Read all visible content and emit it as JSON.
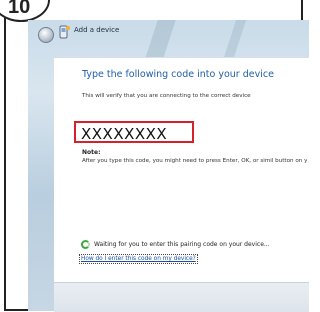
{
  "step": {
    "number": "10"
  },
  "window": {
    "title": "Add a device"
  },
  "main": {
    "heading": "Type the following code into your device",
    "subheading": "This will verify that you are connecting to the correct device",
    "code": "XXXXXXXX",
    "note_label": "Note:",
    "note_text": "After you type this code, you might need to press Enter, OK, or simil button on your device.",
    "waiting_text": "Waiting for you to enter this pairing code on your device...",
    "help_link": "How do I enter this code on my device?"
  },
  "colors": {
    "heading": "#1f5fa8",
    "code_border": "#d8202a",
    "link": "#1b4fa0"
  }
}
